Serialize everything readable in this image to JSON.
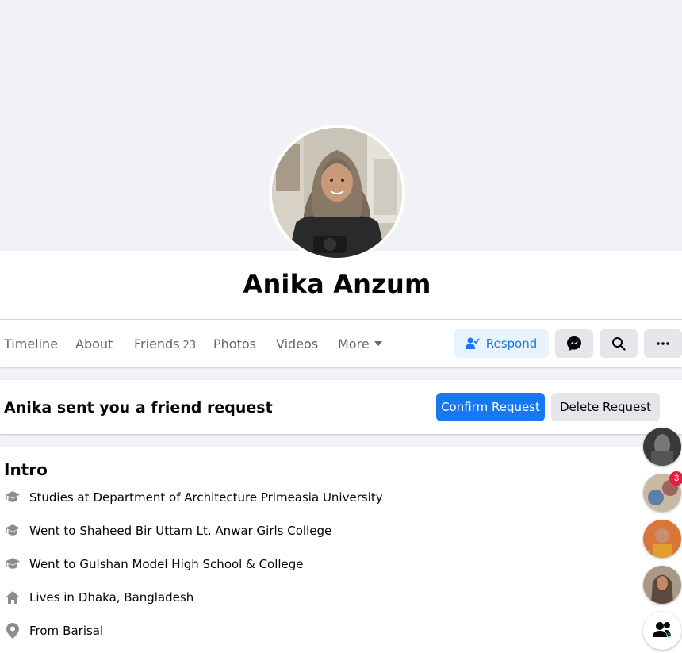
{
  "profile": {
    "name": "Anika Anzum"
  },
  "nav": {
    "tabs": [
      {
        "label": "Timeline"
      },
      {
        "label": "About"
      },
      {
        "label": "Friends",
        "count": "23"
      },
      {
        "label": "Photos"
      },
      {
        "label": "Videos"
      },
      {
        "label": "More"
      }
    ],
    "respond_label": "Respond"
  },
  "friend_request": {
    "text": "Anika sent you a friend request",
    "confirm_label": "Confirm Request",
    "delete_label": "Delete Request"
  },
  "intro": {
    "title": "Intro",
    "items": [
      {
        "icon": "graduation-cap-icon",
        "prefix": "Studies at",
        "value": "Department of Architecture Primeasia University"
      },
      {
        "icon": "graduation-cap-icon",
        "prefix": "Went to",
        "value": "Shaheed Bir Uttam Lt. Anwar Girls College"
      },
      {
        "icon": "graduation-cap-icon",
        "prefix": "Went to",
        "value": "Gulshan Model High School & College"
      },
      {
        "icon": "home-icon",
        "prefix": "Lives in",
        "value": "Dhaka, Bangladesh"
      },
      {
        "icon": "location-pin-icon",
        "prefix": "From",
        "value": "Barisal"
      }
    ]
  },
  "chat_heads": {
    "unread_badge": "3",
    "contacts_badge": "0"
  },
  "colors": {
    "accent": "#1877f2",
    "accent_light": "#e7f3ff",
    "background": "#f0f2f5",
    "secondary_button": "#e4e6eb"
  }
}
